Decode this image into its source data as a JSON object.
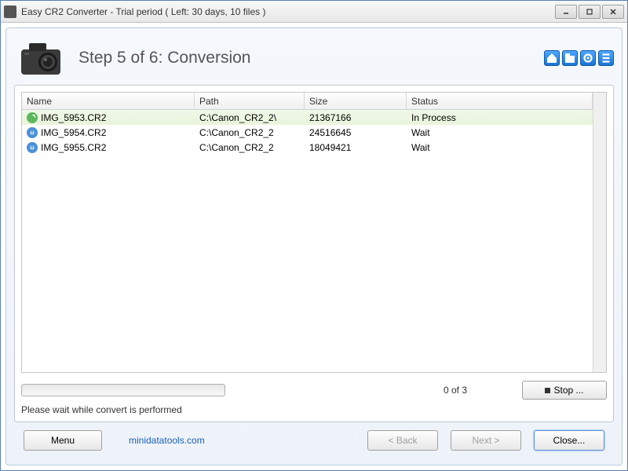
{
  "window": {
    "title": "Easy CR2 Converter - Trial period ( Left: 30 days, 10 files )"
  },
  "header": {
    "step_title": "Step 5 of 6: Conversion"
  },
  "tool_icons": [
    "home-icon",
    "folder-icon",
    "gear-icon",
    "list-icon"
  ],
  "table": {
    "headers": {
      "name": "Name",
      "path": "Path",
      "size": "Size",
      "status": "Status"
    },
    "rows": [
      {
        "name": "IMG_5953.CR2",
        "path": "C:\\Canon_CR2_2\\",
        "size": "21367166",
        "status": "In Process",
        "active": true
      },
      {
        "name": "IMG_5954.CR2",
        "path": "C:\\Canon_CR2_2",
        "size": "24516645",
        "status": "Wait",
        "active": false
      },
      {
        "name": "IMG_5955.CR2",
        "path": "C:\\Canon_CR2_2",
        "size": "18049421",
        "status": "Wait",
        "active": false
      }
    ]
  },
  "progress": {
    "counter": "0 of 3",
    "stop_label": "Stop ..."
  },
  "wait_message": "Please wait while convert is performed",
  "footer": {
    "menu_label": "Menu",
    "link": "minidatatools.com",
    "back_label": "< Back",
    "next_label": "Next >",
    "close_label": "Close..."
  }
}
